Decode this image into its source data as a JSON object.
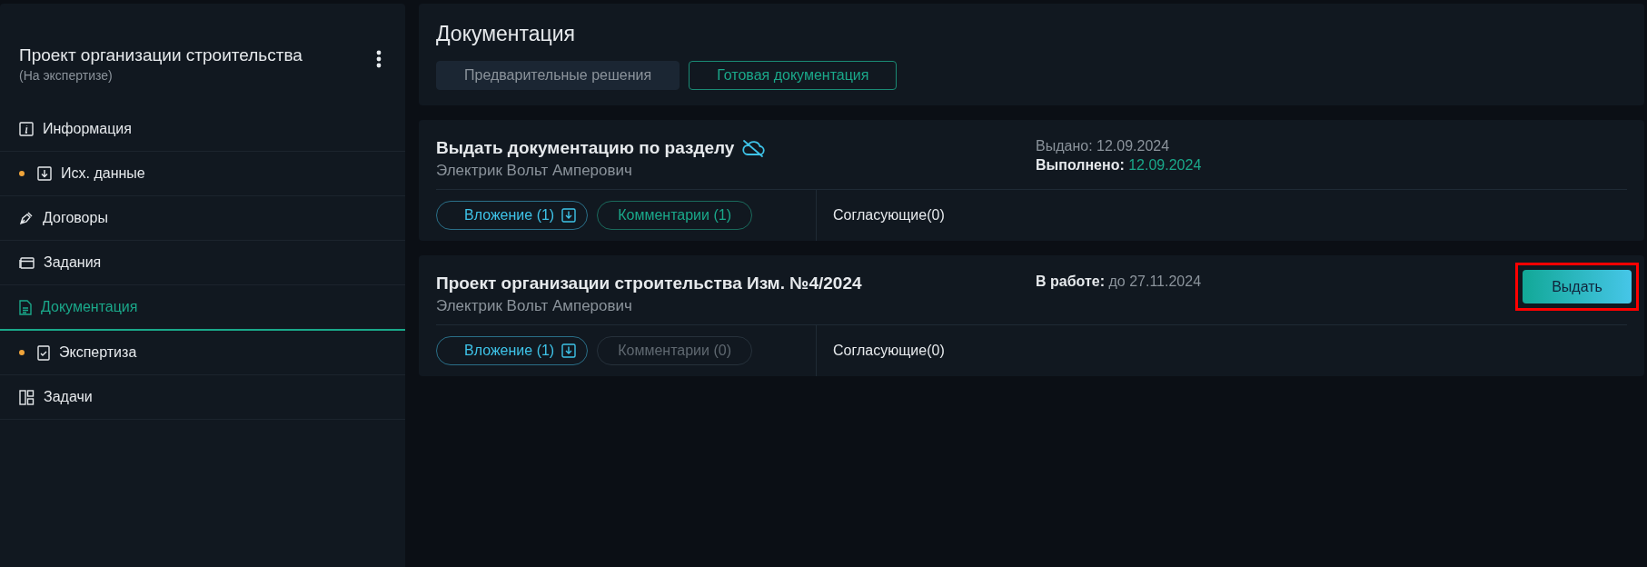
{
  "project": {
    "title": "Проект организации строительства",
    "status": "(На экспертизе)"
  },
  "sidebar": {
    "items": [
      {
        "label": "Информация",
        "selected": false,
        "dot": false
      },
      {
        "label": "Исх. данные",
        "selected": false,
        "dot": true
      },
      {
        "label": "Договоры",
        "selected": false,
        "dot": false
      },
      {
        "label": "Задания",
        "selected": false,
        "dot": false
      },
      {
        "label": "Документация",
        "selected": true,
        "dot": false
      },
      {
        "label": "Экспертиза",
        "selected": false,
        "dot": true
      },
      {
        "label": "Задачи",
        "selected": false,
        "dot": false
      }
    ]
  },
  "header": {
    "title": "Документация",
    "tabs": [
      {
        "label": "Предварительные решения",
        "selected": false
      },
      {
        "label": "Готовая документация",
        "selected": true
      }
    ]
  },
  "cards": [
    {
      "title": "Выдать документацию по разделу",
      "cloud_off": true,
      "author": "Электрик Вольт Амперович",
      "meta": [
        {
          "kind": "issued",
          "label": "Выдано:",
          "value": "12.09.2024"
        },
        {
          "kind": "done",
          "label": "Выполнено:",
          "value": "12.09.2024"
        }
      ],
      "attachment": "Вложение (1)",
      "comments": {
        "label": "Комментарии (1)",
        "disabled": false
      },
      "approvers": "Согласующие(0)"
    },
    {
      "title": "Проект организации строительства Изм. №4/2024",
      "cloud_off": false,
      "author": "Электрик Вольт Амперович",
      "meta": [
        {
          "kind": "in_progress",
          "label": "В работе:",
          "value": "до 27.11.2024"
        }
      ],
      "action": {
        "label": "Выдать",
        "highlighted": true
      },
      "attachment": "Вложение (1)",
      "comments": {
        "label": "Комментарии (0)",
        "disabled": true
      },
      "approvers": "Согласующие(0)"
    }
  ]
}
